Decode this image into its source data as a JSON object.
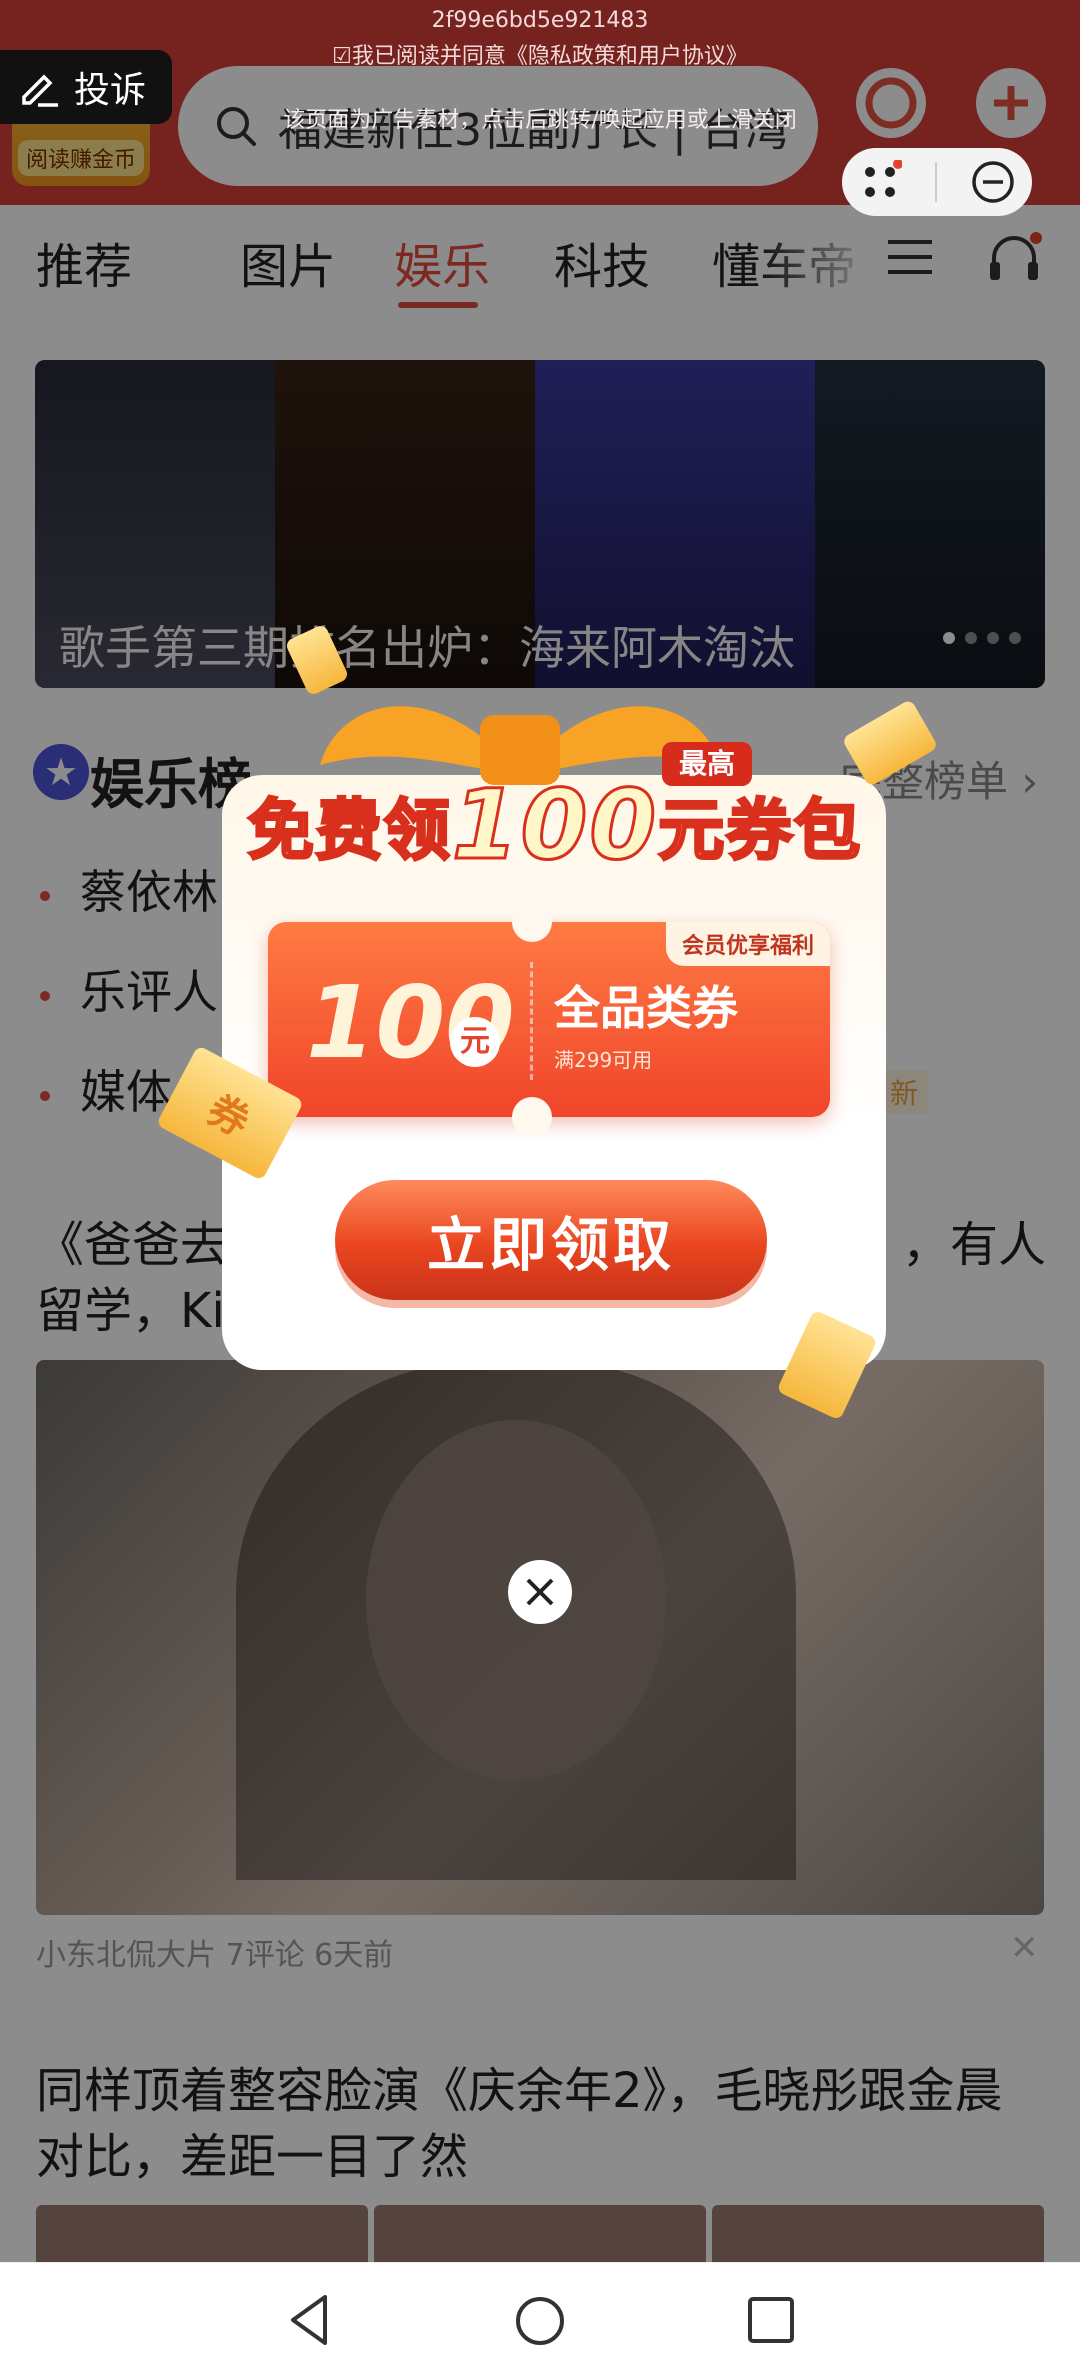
{
  "status": {
    "hash_text": "2f99e6bd5e921483",
    "agree_text": "☑我已阅读并同意《隐私政策和用户协议》"
  },
  "report": {
    "label": "投诉",
    "icon": "pencil-icon"
  },
  "header": {
    "coin_label": "阅读赚金币",
    "search_text": "福建新任3位副厅长 | 台湾",
    "ad_hint": "该页面为广告素材，点击后跳转/唤起应用或上滑关闭"
  },
  "tabs": [
    {
      "label": "推荐"
    },
    {
      "label": "图片"
    },
    {
      "label": "娱乐"
    },
    {
      "label": "科技"
    },
    {
      "label": "懂车帝"
    }
  ],
  "banner": {
    "caption": "歌手第三期排名出炉：海来阿木淘汰"
  },
  "rank": {
    "title": "娱乐榜",
    "more": "完整榜单 ›",
    "items": [
      {
        "text": "蔡依林"
      },
      {
        "text": "乐评人"
      },
      {
        "text": "媒体"
      }
    ],
    "new_badge": "新"
  },
  "article1": {
    "title_line1": "《爸爸去",
    "title_line1_tail": "，有人",
    "title_line2": "留学，Ki",
    "meta": "小东北侃大片  7评论  6天前"
  },
  "article2": {
    "title": "同样顶着整容脸演《庆余年2》，毛晓彤跟金晨对比，差距一目了然"
  },
  "popup": {
    "head_a": "免费领",
    "head_num": "100",
    "head_b": "元券包",
    "max_badge": "最高",
    "coupon_amount": "100",
    "coupon_unit": "元",
    "coupon_type": "全品类券",
    "coupon_condition": "满299可用",
    "coupon_perk": "会员优享福利",
    "cta": "立即领取",
    "ticket_text": "券"
  },
  "colors": {
    "brand_red": "#d8403a",
    "active_tab": "#e24b3c",
    "cta": "#e9451f"
  }
}
